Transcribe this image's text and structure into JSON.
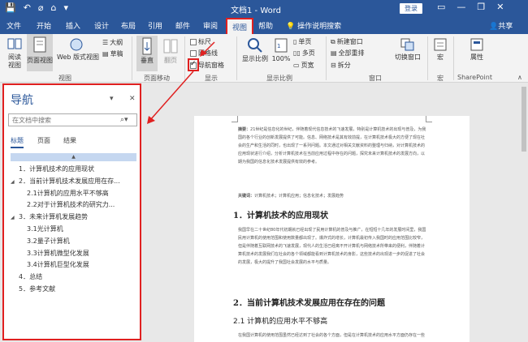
{
  "titlebar": {
    "title": "文档1 - Word",
    "login_label": "登录",
    "quick_access": [
      "💾",
      "↶",
      "⌀",
      "⌂",
      "▾"
    ],
    "win_buttons": [
      "▭",
      "—",
      "❐",
      "✕"
    ]
  },
  "tabs": [
    {
      "label": "文件",
      "active": false
    },
    {
      "label": "开始",
      "active": false
    },
    {
      "label": "插入",
      "active": false
    },
    {
      "label": "设计",
      "active": false
    },
    {
      "label": "布局",
      "active": false
    },
    {
      "label": "引用",
      "active": false
    },
    {
      "label": "邮件",
      "active": false
    },
    {
      "label": "审阅",
      "active": false
    },
    {
      "label": "视图",
      "active": true
    },
    {
      "label": "帮助",
      "active": false
    }
  ],
  "tell_me": "操作说明搜索",
  "share_label": "共享",
  "ribbon": {
    "views": {
      "read_mode": "阅读视图",
      "print_layout": "页面视图",
      "web_layout": "Web 版式视图",
      "outline": "大纲",
      "draft": "草稿",
      "group_label": "视图"
    },
    "page_move": {
      "vertical": "垂直",
      "side": "翻页",
      "group_label": "页面移动"
    },
    "show": {
      "ruler": "标尺",
      "gridlines": "网格线",
      "nav_pane": "导航窗格",
      "group_label": "显示"
    },
    "zoom": {
      "zoom": "显示比例",
      "hundred": "100%",
      "one_page": "单页",
      "multi_page": "多页",
      "page_width": "页宽",
      "group_label": "显示比例"
    },
    "window": {
      "new_window": "新建窗口",
      "arrange_all": "全部重排",
      "split": "拆分",
      "switch_windows": "切换窗口",
      "group_label": "窗口"
    },
    "macros": {
      "macros": "宏",
      "group_label": "宏"
    },
    "sharepoint": {
      "properties": "属性",
      "group_label": "SharePoint"
    }
  },
  "nav": {
    "title": "导航",
    "search_placeholder": "在文档中搜索",
    "tabs": [
      "标题",
      "页面",
      "结果"
    ],
    "items": [
      {
        "text": "1．计算机技术的应用现状",
        "level": 1,
        "expand": "",
        "selected": false
      },
      {
        "text": "2．当前计算机技术发展应用在存...",
        "level": 1,
        "expand": "◢",
        "selected": false
      },
      {
        "text": "2.1计算机的应用水平不够高",
        "level": 2,
        "expand": "",
        "selected": false
      },
      {
        "text": "2.2对于计算机技术的研究力...",
        "level": 2,
        "expand": "",
        "selected": false
      },
      {
        "text": "3．未来计算机发展趋势",
        "level": 1,
        "expand": "◢",
        "selected": false
      },
      {
        "text": "3.1光计算机",
        "level": 2,
        "expand": "",
        "selected": false
      },
      {
        "text": "3.2量子计算机",
        "level": 2,
        "expand": "",
        "selected": false
      },
      {
        "text": "3.3计算机微型化发展",
        "level": 2,
        "expand": "",
        "selected": false
      },
      {
        "text": "3.4计算机巨型化发展",
        "level": 2,
        "expand": "",
        "selected": false
      },
      {
        "text": "4．总结",
        "level": 1,
        "expand": "",
        "selected": false
      },
      {
        "text": "5．参考文献",
        "level": 1,
        "expand": "",
        "selected": false
      }
    ]
  },
  "document": {
    "abstract_label": "摘要：",
    "abstract": "21世纪是信息化的世纪，伴随着现代信息技术的飞速发展，特别是计算机技术的出现与普及，为我国的各个行业的创新发展提供了可能。信息、网络技术是其有效前提，在计算机技术极大的方便了现在社会的生产和生活的同时，也出现了一系列问题。本文通过对相关文献资料的整理与归纳，对计算机技术的应用现状进行介绍，分析计算机技术在当前应用过程中存在的问题，探究未来计算机技术的发展方向，以期为我国的信息化技术发展提供有效的参考。",
    "keywords_label": "关键词：",
    "keywords": "计算机技术；计算机应用；信息化技术；发展趋势",
    "h1_1": "1．计算机技术的应用现状",
    "para1": "我国早在二十世纪80年代初期就已经出现了民用计算机的普及与推广，在短短十几年的发展时间里，我国民用计算机的使用范围和使用数量都出现了。爆炸式的增长，计算机最初传入我国时的应用范围比较窄，但是伴随着互联网技术的飞速发展，现代人的生活已经离不开计算机与网络技术所带来的便利，伴随着计算机技术的发展我们在社会的各个领域都能看到计算机技术的身影，这些技术的出现进一步的促进了社会的发展，极大的提升了我国社会发展的水平与质量。",
    "h1_2": "2．当前计算机技术发展应用在存在的问题",
    "h2_1": "2.1 计算机的应用水平不够高",
    "para2": "在我国计算机的使用范围虽然已经达到了社会的各个方面，但是在计算机技术的应用水平方面仍存在一些不足..."
  }
}
